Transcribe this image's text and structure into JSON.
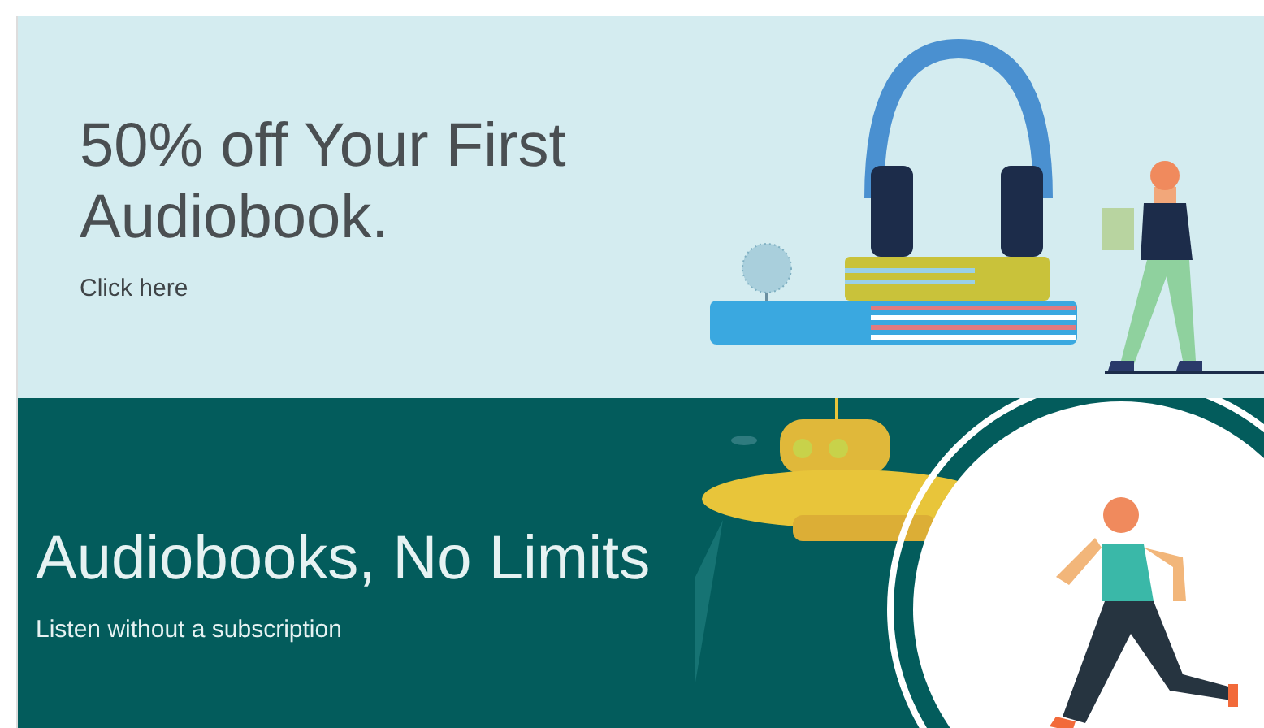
{
  "banners": [
    {
      "kind": "offer",
      "headline": "50% off Your First Audiobook.",
      "link": "Click here"
    },
    {
      "kind": "subscription",
      "headline": "Audiobooks, No Limits",
      "subtitle": "Listen without a subscription"
    }
  ]
}
